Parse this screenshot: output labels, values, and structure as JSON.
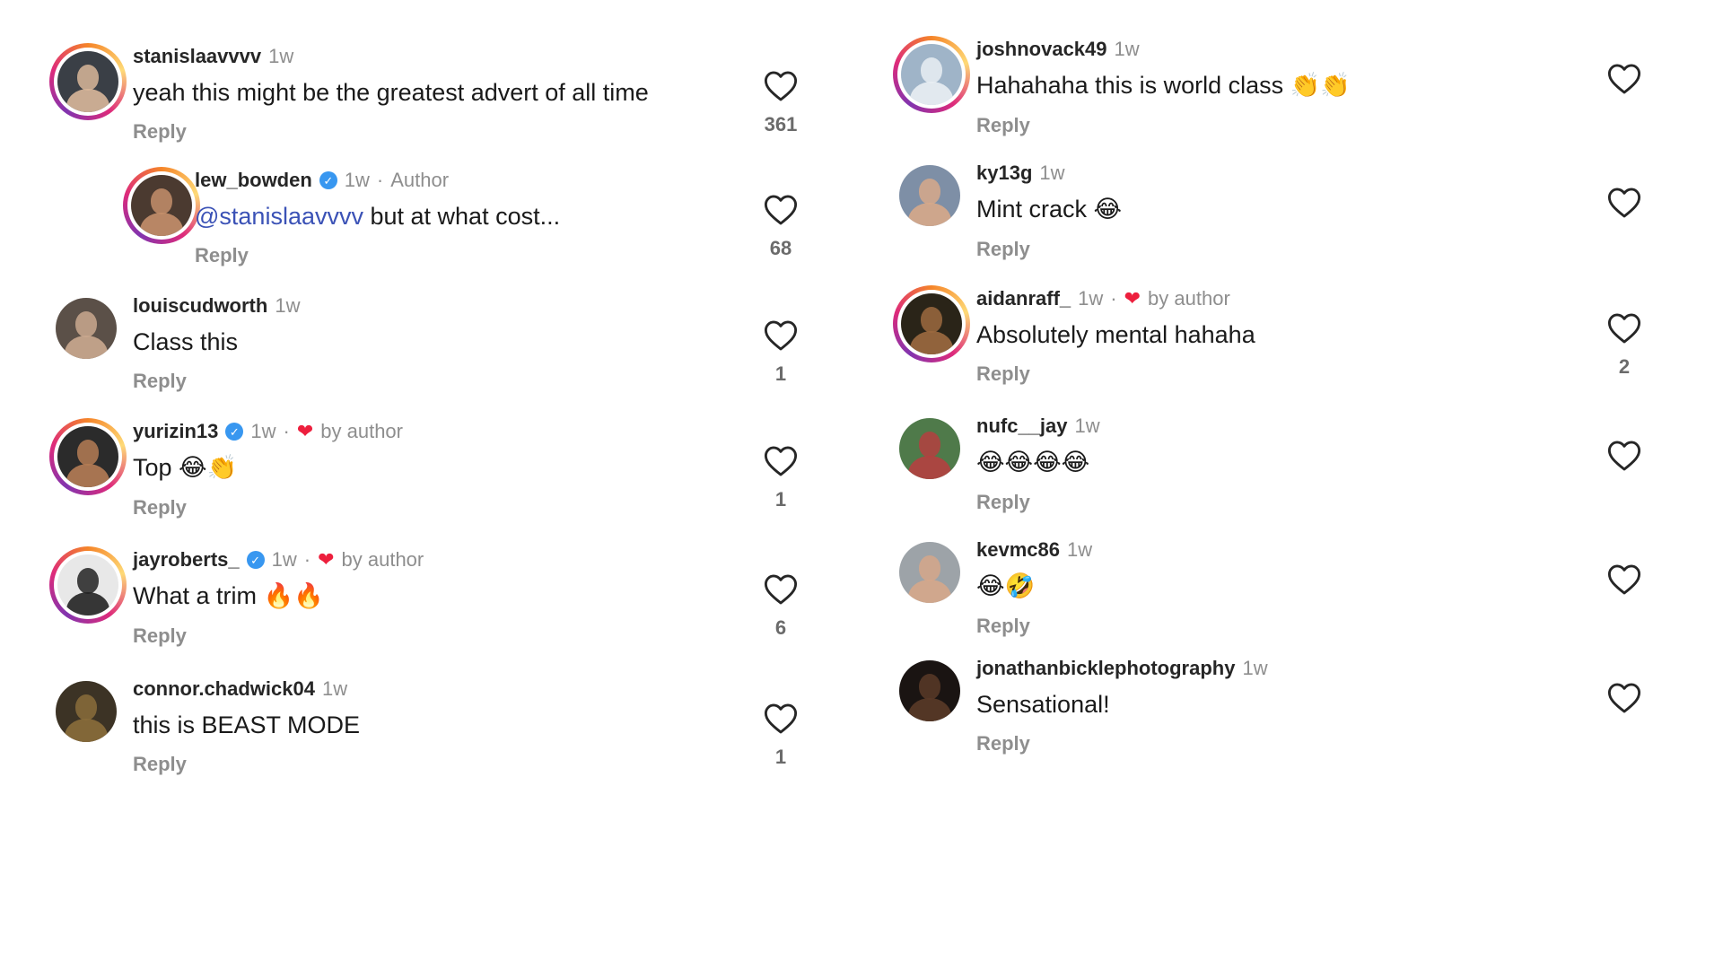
{
  "left_comments": [
    {
      "username": "stanislaavvvv",
      "time": "1w",
      "verified": false,
      "tag": "",
      "liked_by_author": false,
      "mention": "",
      "text": "yeah this might be the greatest advert of all time",
      "emoji": "",
      "reply": "Reply",
      "likes": "361",
      "story_ring": true,
      "avatar_colors": [
        "#3a3f46",
        "#d9b79a"
      ]
    },
    {
      "username": "lew_bowden",
      "time": "1w",
      "verified": true,
      "tag": "Author",
      "liked_by_author": false,
      "mention": "@stanislaavvvv",
      "text": " but at what cost...",
      "emoji": "",
      "reply": "Reply",
      "likes": "68",
      "story_ring": true,
      "avatar_colors": [
        "#4b3a30",
        "#c48f6b"
      ]
    },
    {
      "username": "louiscudworth",
      "time": "1w",
      "verified": false,
      "tag": "",
      "liked_by_author": false,
      "mention": "",
      "text": "Class this",
      "emoji": "",
      "reply": "Reply",
      "likes": "1",
      "story_ring": false,
      "avatar_colors": [
        "#5b5048",
        "#caa88f"
      ]
    },
    {
      "username": "yurizin13",
      "time": "1w",
      "verified": true,
      "tag": "by author",
      "liked_by_author": true,
      "mention": "",
      "text": "Top ",
      "emoji": "😂👏",
      "reply": "Reply",
      "likes": "1",
      "story_ring": true,
      "avatar_colors": [
        "#2b2b2b",
        "#b57c55"
      ]
    },
    {
      "username": "jayroberts_",
      "time": "1w",
      "verified": true,
      "tag": "by author",
      "liked_by_author": true,
      "mention": "",
      "text": "What a trim ",
      "emoji": "🔥🔥",
      "reply": "Reply",
      "likes": "6",
      "story_ring": true,
      "avatar_colors": [
        "#e8e8e8",
        "#222222"
      ]
    },
    {
      "username": "connor.chadwick04",
      "time": "1w",
      "verified": false,
      "tag": "",
      "liked_by_author": false,
      "mention": "",
      "text": "this is BEAST MODE",
      "emoji": "",
      "reply": "Reply",
      "likes": "1",
      "story_ring": false,
      "avatar_colors": [
        "#3c3325",
        "#8a6d3b"
      ]
    }
  ],
  "right_comments": [
    {
      "username": "joshnovack49",
      "time": "1w",
      "verified": false,
      "tag": "",
      "liked_by_author": false,
      "mention": "",
      "text": "Hahahaha this is world class ",
      "emoji": "👏👏",
      "reply": "Reply",
      "likes": "",
      "story_ring": true,
      "avatar_colors": [
        "#9fb4c8",
        "#e9eef3"
      ]
    },
    {
      "username": "ky13g",
      "time": "1w",
      "verified": false,
      "tag": "",
      "liked_by_author": false,
      "mention": "",
      "text": "Mint crack ",
      "emoji": "😂",
      "reply": "Reply",
      "likes": "",
      "story_ring": false,
      "avatar_colors": [
        "#7e8fa6",
        "#d7a98a"
      ]
    },
    {
      "username": "aidanraff_",
      "time": "1w",
      "verified": false,
      "tag": "by author",
      "liked_by_author": true,
      "mention": "",
      "text": "Absolutely mental hahaha",
      "emoji": "",
      "reply": "Reply",
      "likes": "2",
      "story_ring": true,
      "avatar_colors": [
        "#2a2418",
        "#9c6a40"
      ]
    },
    {
      "username": "nufc__jay",
      "time": "1w",
      "verified": false,
      "tag": "",
      "liked_by_author": false,
      "mention": "",
      "text": "",
      "emoji": "😂😂😂😂",
      "reply": "Reply",
      "likes": "",
      "story_ring": false,
      "avatar_colors": [
        "#4f7a4a",
        "#b44040"
      ]
    },
    {
      "username": "kevmc86",
      "time": "1w",
      "verified": false,
      "tag": "",
      "liked_by_author": false,
      "mention": "",
      "text": "",
      "emoji": "😂🤣",
      "reply": "Reply",
      "likes": "",
      "story_ring": false,
      "avatar_colors": [
        "#9da3a8",
        "#d6a78a"
      ]
    },
    {
      "username": "jonathanbicklephotography",
      "time": "1w",
      "verified": false,
      "tag": "",
      "liked_by_author": false,
      "mention": "",
      "text": "Sensational!",
      "emoji": "",
      "reply": "Reply",
      "likes": "",
      "story_ring": false,
      "avatar_colors": [
        "#1a1412",
        "#5a3a28"
      ]
    }
  ],
  "colors": {
    "accent_heart": "#ed1f3d",
    "mention": "#3b52b6",
    "verified": "#3897f0",
    "muted": "#8e8e8e"
  },
  "icons": {
    "like": "heart-outline-icon",
    "liked_by_author": "heart-filled-icon",
    "verified": "verified-badge-icon"
  }
}
